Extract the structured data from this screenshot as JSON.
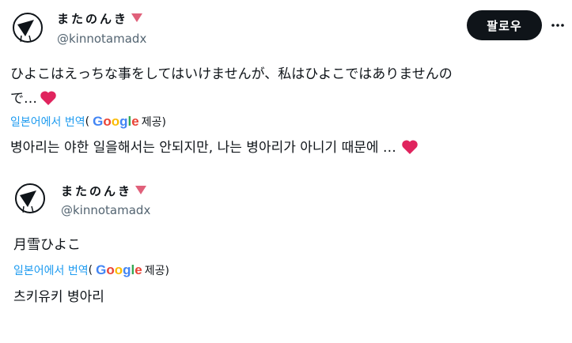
{
  "post": {
    "author": {
      "display_name": "またのんき",
      "handle": "@kinnotamadx"
    },
    "follow_label": "팔로우",
    "text": "ひよこはえっちな事をしてはいけませんが、私はひよこではありませんの",
    "text_line2": "で…",
    "translate": {
      "link_label": "일본어에서 번역",
      "open_paren": "(",
      "provider": [
        "G",
        "o",
        "o",
        "g",
        "l",
        "e"
      ],
      "suffix": "제공)"
    },
    "translation": "병아리는 야한 일을해서는 안되지만, 나는 병아리가 아니기 때문에 …"
  },
  "quoted": {
    "author": {
      "display_name": "またのんき",
      "handle": "@kinnotamadx"
    },
    "text": "月雪ひよこ",
    "translate": {
      "link_label": "일본어에서 번역",
      "open_paren": "(",
      "provider": [
        "G",
        "o",
        "o",
        "g",
        "l",
        "e"
      ],
      "suffix": "제공)"
    },
    "translation": "츠키유키 병아리"
  },
  "icons": {
    "more": "more-horizontal-icon",
    "heart": "red-heart-emoji",
    "name_badge": "pink-triangle-emoji"
  },
  "colors": {
    "link": "#1d9bf0",
    "heart": "#e0245e",
    "triangle": "#e0607a",
    "follow_bg": "#0f1419"
  }
}
